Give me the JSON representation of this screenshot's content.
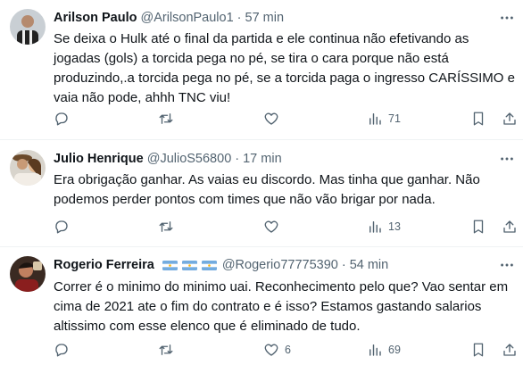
{
  "colors": {
    "text_primary": "#0f1419",
    "text_secondary": "#536471",
    "divider": "#eff3f4",
    "flag_blue": "#74acdf",
    "flag_sun": "#f6b40e"
  },
  "tweets": [
    {
      "name": "Arilson Paulo",
      "handle": "@ArilsonPaulo1",
      "separator": "·",
      "time": "57 min",
      "flags": 0,
      "text": "Se deixa o Hulk até o final da partida e ele continua não efetivando as\njogadas (gols) a torcida pega no pé, se tira o cara porque não está\nproduzindo,.a torcida pega no pé, se a torcida paga o ingresso CARÍSSIMO e\nvaia não pode, ahhh TNC viu!",
      "replies": "",
      "retweets": "",
      "likes": "",
      "views": "71"
    },
    {
      "name": "Julio Henrique",
      "handle": "@JulioS56800",
      "separator": "·",
      "time": "17 min",
      "flags": 0,
      "text": "Era obrigação ganhar. As vaias eu discordo. Mas tinha que ganhar. Não\npodemos perder pontos com times que não vão brigar por nada.",
      "replies": "",
      "retweets": "",
      "likes": "",
      "views": "13"
    },
    {
      "name": "Rogerio Ferreira",
      "handle": "@Rogerio77775390",
      "separator": "·",
      "time": "54 min",
      "flags": 3,
      "text": "Correr é o minimo do minimo uai. Reconhecimento pelo que? Vao sentar em\ncima de  2021 ate o fim do contrato e é isso? Estamos gastando salarios\naltissimo com esse elenco que é eliminado de tudo.",
      "replies": "",
      "retweets": "",
      "likes": "6",
      "views": "69"
    }
  ]
}
